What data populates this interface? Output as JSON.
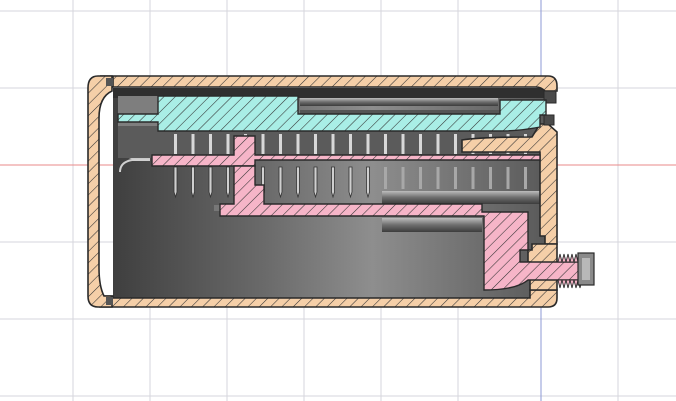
{
  "viewport": {
    "background": "#ffffff",
    "grid_color": "#d6d6dc",
    "axis_x_color": "#e88a8a",
    "axis_y_color": "#8e9ad6"
  },
  "materials": {
    "housing_fill": "#f5cfa8",
    "housing_edge": "#2a2a2a",
    "slider_fill": "#a9eee6",
    "spring_part_fill": "#f6b5c8",
    "hatch_color": "#333333",
    "interior_dark": "#4c4c4c",
    "interior_light": "#9a9a9a"
  },
  "parts": [
    {
      "id": "outer-housing",
      "label": ""
    },
    {
      "id": "slider",
      "label": ""
    },
    {
      "id": "spring-contact-carrier",
      "label": ""
    },
    {
      "id": "threaded-nozzle",
      "label": ""
    }
  ]
}
